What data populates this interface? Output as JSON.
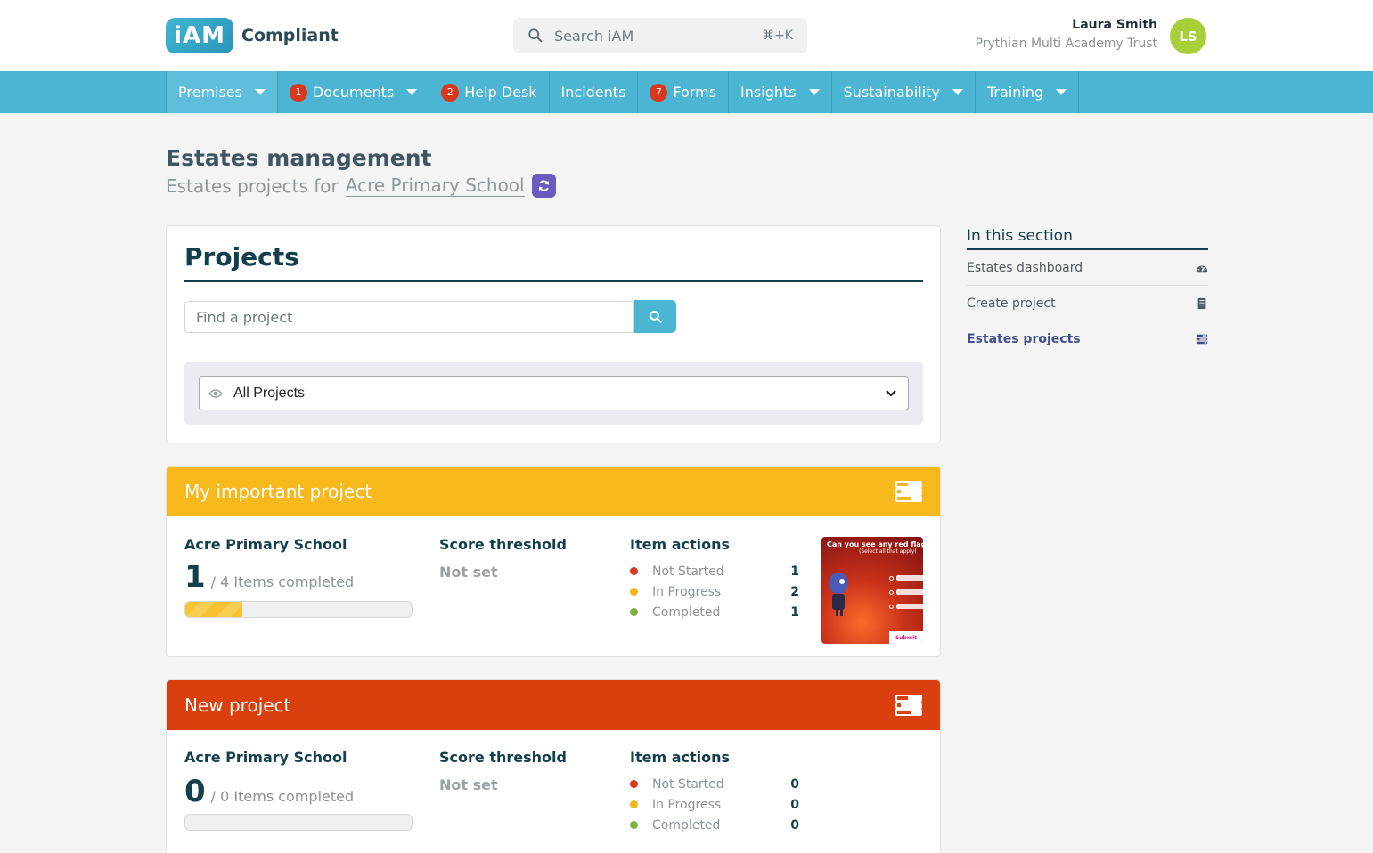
{
  "header": {
    "logo_mark": "iAM",
    "logo_text": "Compliant",
    "search_placeholder": "Search iAM",
    "search_shortcut": "⌘+K",
    "user_name": "Laura Smith",
    "user_org": "Prythian Multi Academy Trust",
    "avatar_initials": "LS"
  },
  "nav": {
    "items": [
      {
        "label": "Premises",
        "badge": "",
        "dropdown": true
      },
      {
        "label": "Documents",
        "badge": "1",
        "dropdown": true
      },
      {
        "label": "Help Desk",
        "badge": "2",
        "dropdown": false
      },
      {
        "label": "Incidents",
        "badge": "",
        "dropdown": false
      },
      {
        "label": "Forms",
        "badge": "7",
        "dropdown": false
      },
      {
        "label": "Insights",
        "badge": "",
        "dropdown": true
      },
      {
        "label": "Sustainability",
        "badge": "",
        "dropdown": true
      },
      {
        "label": "Training",
        "badge": "",
        "dropdown": true
      }
    ]
  },
  "page": {
    "title": "Estates management",
    "subtitle_prefix": "Estates projects for",
    "school": "Acre Primary School"
  },
  "projects_panel": {
    "title": "Projects",
    "find_placeholder": "Find a project",
    "filter_value": "All Projects"
  },
  "cards": [
    {
      "title": "My important project",
      "header_color": "#f7b81c",
      "school": "Acre Primary School",
      "completed": "1",
      "total_text": "/ 4 Items completed",
      "progress_fraction": 0.25,
      "score_label": "Score threshold",
      "score_value": "Not set",
      "actions_label": "Item actions",
      "actions": [
        {
          "label": "Not Started",
          "count": "1",
          "color": "#d9381e"
        },
        {
          "label": "In Progress",
          "count": "2",
          "color": "#f2b51a"
        },
        {
          "label": "Completed",
          "count": "1",
          "color": "#7cb342"
        }
      ],
      "thumb_title": "Can you see any red flag",
      "thumb_sub": "(Select all that apply)",
      "thumb_button": "Submit"
    },
    {
      "title": "New project",
      "header_color": "#d9400e",
      "school": "Acre Primary School",
      "completed": "0",
      "total_text": "/ 0 Items completed",
      "progress_fraction": 0,
      "score_label": "Score threshold",
      "score_value": "Not set",
      "actions_label": "Item actions",
      "actions": [
        {
          "label": "Not Started",
          "count": "0",
          "color": "#d9381e"
        },
        {
          "label": "In Progress",
          "count": "0",
          "color": "#f2b51a"
        },
        {
          "label": "Completed",
          "count": "0",
          "color": "#7cb342"
        }
      ]
    }
  ],
  "sidebar": {
    "title": "In this section",
    "items": [
      {
        "label": "Estates dashboard",
        "icon": "dashboard-icon"
      },
      {
        "label": "Create project",
        "icon": "document-icon"
      },
      {
        "label": "Estates projects",
        "icon": "list-icon"
      }
    ]
  }
}
